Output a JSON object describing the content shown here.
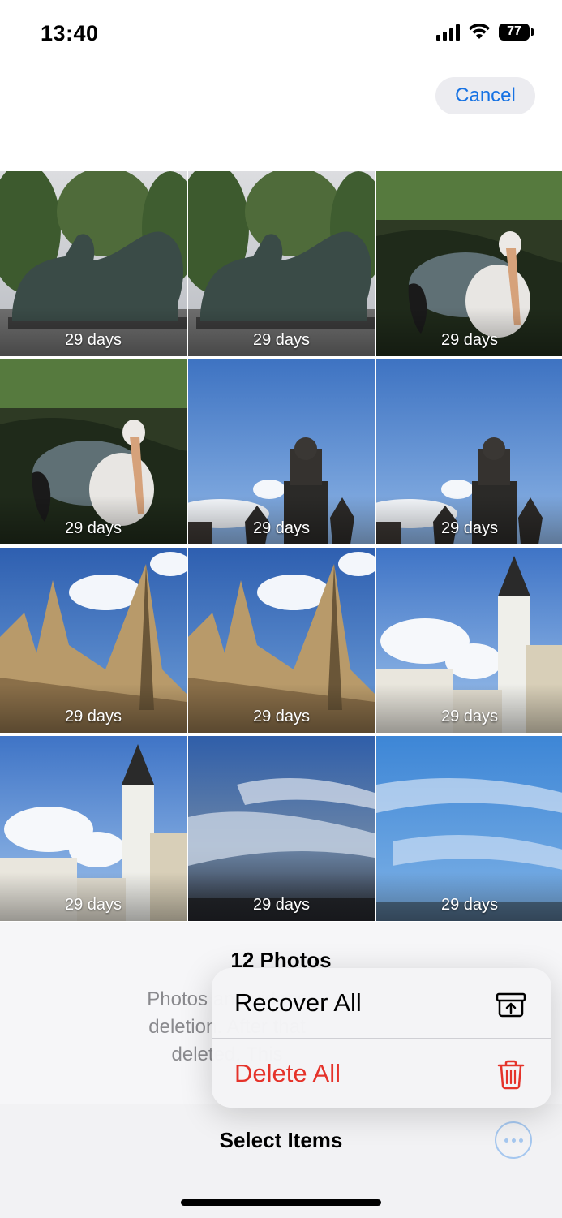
{
  "status_bar": {
    "time": "13:40",
    "battery": "77"
  },
  "header": {
    "cancel_label": "Cancel"
  },
  "photos": [
    {
      "label": "29 days",
      "scene": "lions"
    },
    {
      "label": "29 days",
      "scene": "lions"
    },
    {
      "label": "29 days",
      "scene": "pelican"
    },
    {
      "label": "29 days",
      "scene": "pelican"
    },
    {
      "label": "29 days",
      "scene": "monument"
    },
    {
      "label": "29 days",
      "scene": "monument"
    },
    {
      "label": "29 days",
      "scene": "cathedral"
    },
    {
      "label": "29 days",
      "scene": "cathedral"
    },
    {
      "label": "29 days",
      "scene": "church"
    },
    {
      "label": "29 days",
      "scene": "church"
    },
    {
      "label": "29 days",
      "scene": "sky-dusk"
    },
    {
      "label": "29 days",
      "scene": "sky-blue"
    }
  ],
  "info": {
    "title": "12 Photos",
    "lines": [
      "Photos and videos",
      "deletion. After that",
      "deleted. This"
    ]
  },
  "menu": {
    "recover_label": "Recover All",
    "recover_icon": "archive-restore-icon",
    "delete_label": "Delete All",
    "delete_icon": "trash-icon",
    "delete_color": "#e5332a"
  },
  "toolbar": {
    "title": "Select Items",
    "more_icon": "ellipsis-circle-icon"
  },
  "colors": {
    "accent": "#1672e3",
    "destructive": "#e5332a"
  }
}
